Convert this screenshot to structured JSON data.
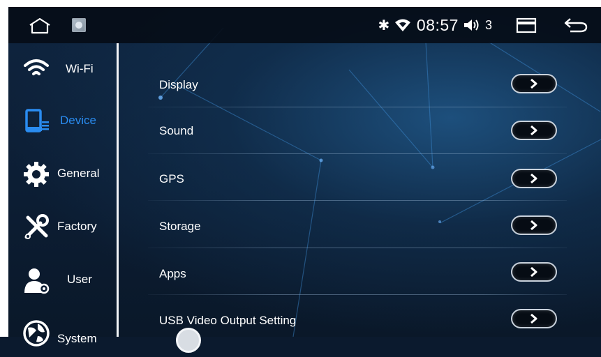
{
  "status_bar": {
    "bluetooth_icon": "bluetooth-icon",
    "wifi_icon": "wifi-signal-icon",
    "time": "08:57",
    "volume_icon": "volume-icon",
    "volume_level": "3",
    "home_icon": "home-icon",
    "recent_apps_icon": "recent-apps-icon",
    "back_icon": "back-icon"
  },
  "sidebar": {
    "items": [
      {
        "label": "Wi-Fi",
        "icon": "wifi-icon",
        "active": false
      },
      {
        "label": "Device",
        "icon": "device-icon",
        "active": true
      },
      {
        "label": "General",
        "icon": "gear-icon",
        "active": false
      },
      {
        "label": "Factory",
        "icon": "tools-icon",
        "active": false
      },
      {
        "label": "User",
        "icon": "user-icon",
        "active": false
      },
      {
        "label": "System",
        "icon": "globe-icon",
        "active": false
      }
    ]
  },
  "main": {
    "rows": [
      {
        "label": "Display"
      },
      {
        "label": "Sound"
      },
      {
        "label": "GPS"
      },
      {
        "label": "Storage"
      },
      {
        "label": "Apps"
      },
      {
        "label": "USB Video Output Setting"
      }
    ]
  },
  "colors": {
    "accent": "#2a8cf0",
    "background": "#0b1a2e",
    "text": "#ffffff"
  }
}
